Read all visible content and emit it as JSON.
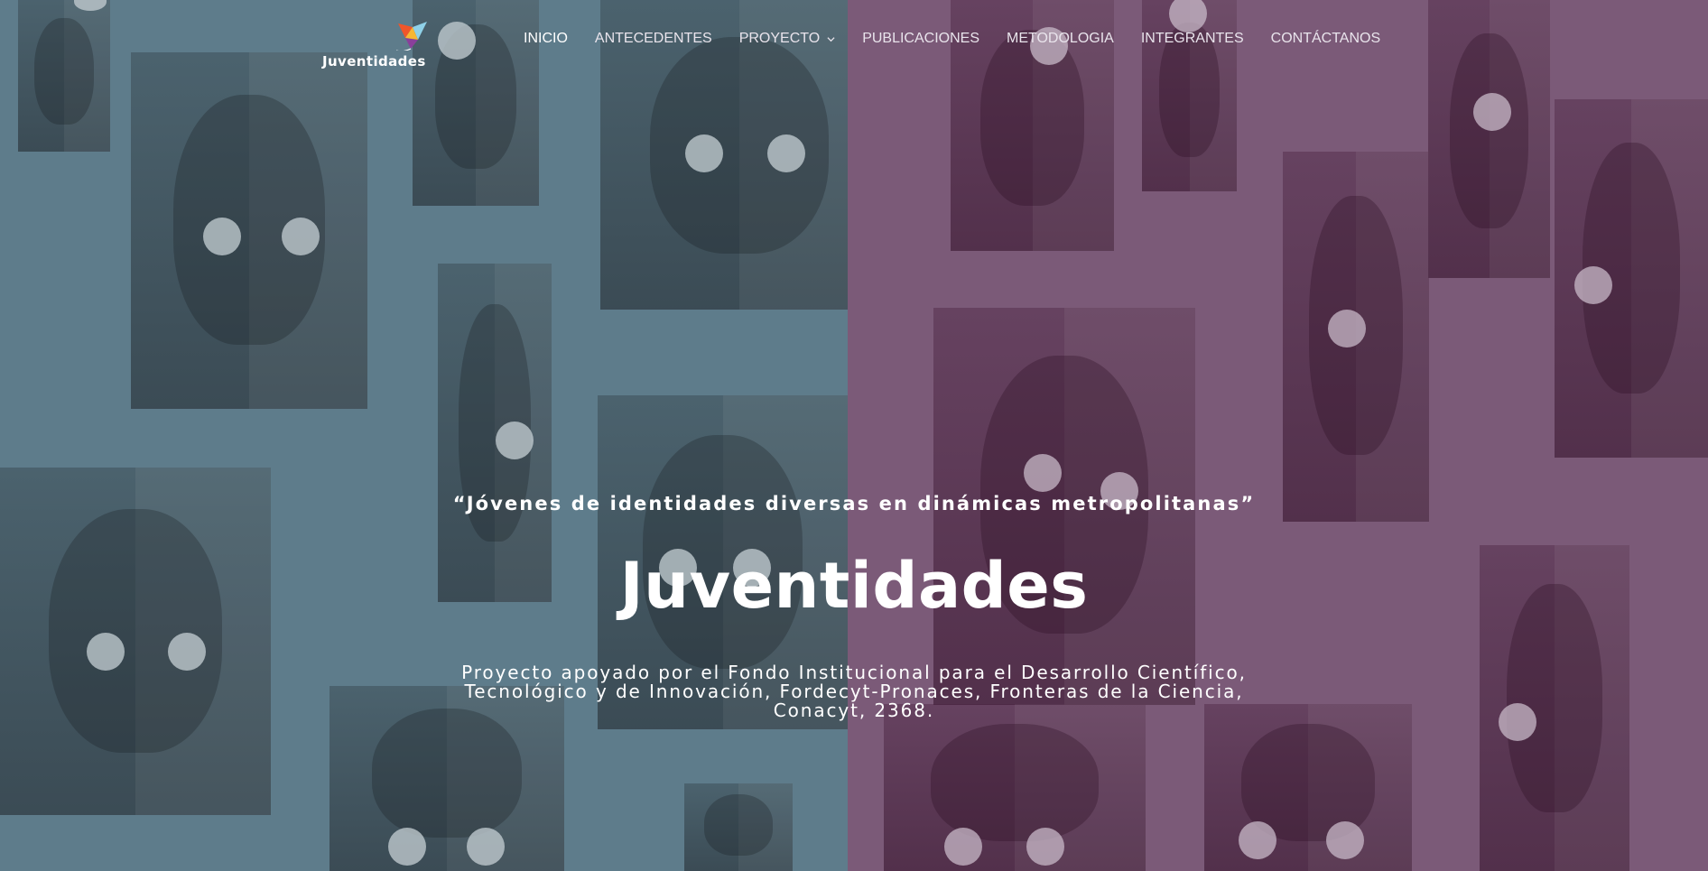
{
  "brand": {
    "name": "Juventidades",
    "colors": {
      "left_panel": "#5e7c8b",
      "right_panel": "#7b5a78",
      "text": "#ffffff"
    }
  },
  "nav": {
    "items": [
      {
        "label": "INICIO",
        "active": true
      },
      {
        "label": "ANTECEDENTES",
        "active": false
      },
      {
        "label": "PROYECTO",
        "active": false,
        "has_dropdown": true
      },
      {
        "label": "PUBLICACIONES",
        "active": false
      },
      {
        "label": "METODOLOGIA",
        "active": false
      },
      {
        "label": "INTEGRANTES",
        "active": false
      },
      {
        "label": "CONTÁCTANOS",
        "active": false
      }
    ],
    "dropdown_icon": "chevron-down-icon"
  },
  "hero": {
    "quote": "“Jóvenes de identidades diversas en dinámicas metropolitanas”",
    "title": "Juventidades",
    "subtitle": "Proyecto apoyado por el Fondo Institucional para el Desarrollo Científico, Tecnológico y de Innovación, Fordecyt-Pronaces, Fronteras de la Ciencia, Conacyt, 2368."
  }
}
